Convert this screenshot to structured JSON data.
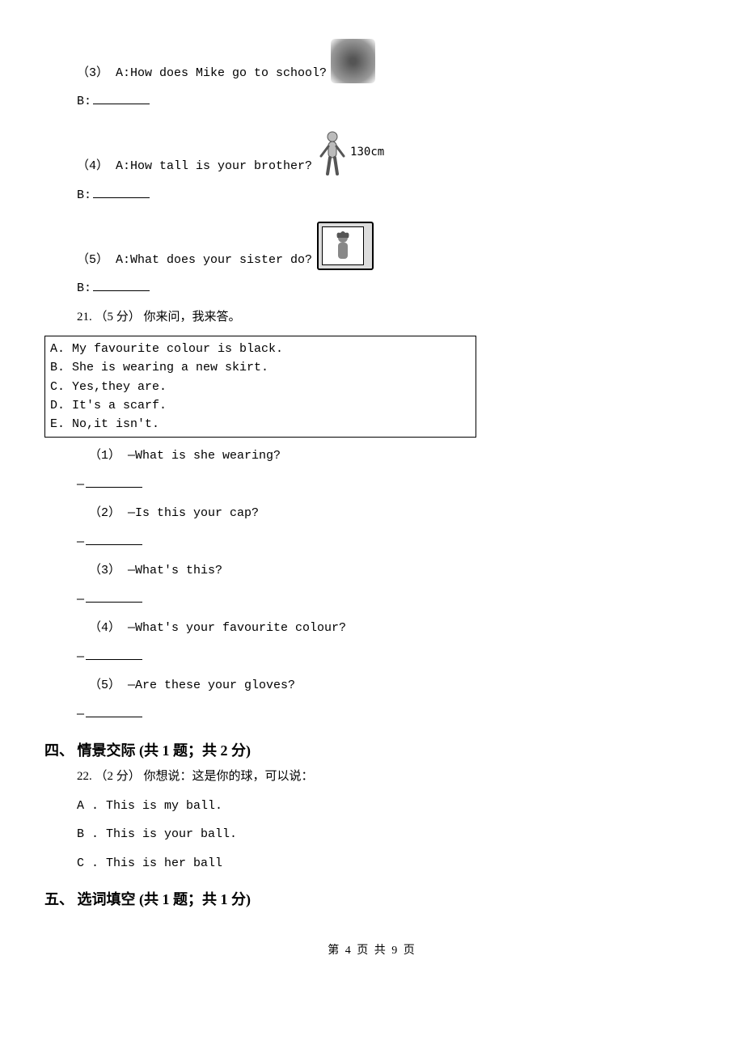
{
  "q3": {
    "label": "（3） A:How does Mike go to school?",
    "answer_prefix": "B:"
  },
  "q4": {
    "label": "（4） A:How tall is your brother?",
    "img_label": "130cm",
    "answer_prefix": "B:"
  },
  "q5": {
    "label": "（5） A:What does your sister do?",
    "answer_prefix": "B:"
  },
  "q21": {
    "header": "21. （5 分） 你来问，我来答。",
    "box": {
      "a": "A. My favourite colour is black.",
      "b": "B. She is wearing a new skirt.",
      "c": "C. Yes,they are.",
      "d": "D. It's a scarf.",
      "e": "E. No,it isn't."
    },
    "items": {
      "i1": "（1） —What is she wearing?",
      "i2": "（2） —Is this your cap?",
      "i3": "（3） —What's this?",
      "i4": "（4） —What's your favourite colour?",
      "i5": "（5） —Are these your gloves?"
    },
    "dash": "—"
  },
  "section4": {
    "title": "四、 情景交际 (共 1 题；共 2 分)",
    "q22": {
      "header": "22. （2 分） 你想说：这是你的球，可以说：",
      "a": "A . This is my ball.",
      "b": "B . This is your ball.",
      "c": "C . This is her ball"
    }
  },
  "section5": {
    "title": "五、 选词填空 (共 1 题；共 1 分)"
  },
  "footer": "第 4 页 共 9 页"
}
